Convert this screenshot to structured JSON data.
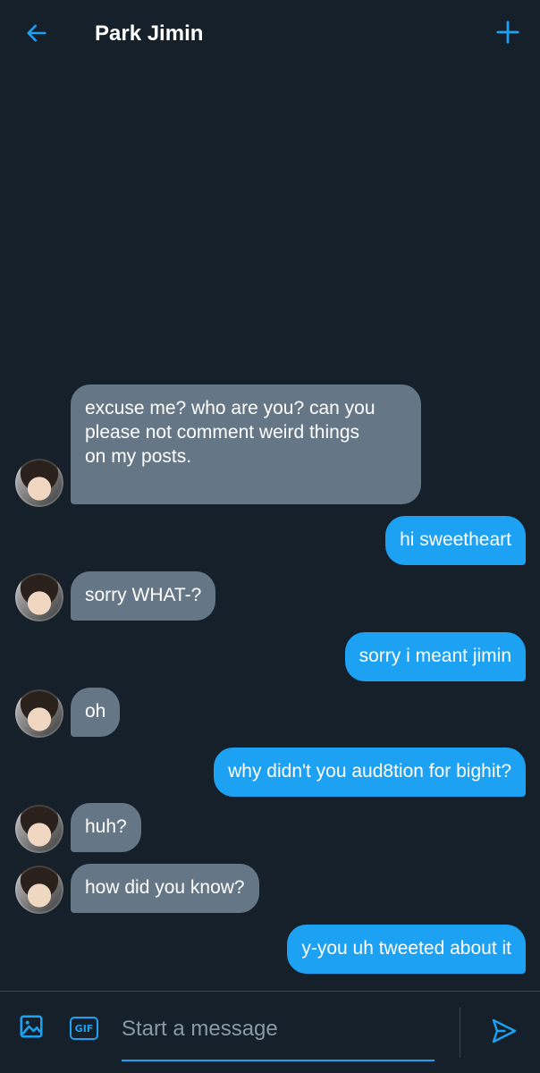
{
  "header": {
    "title": "Park Jimin",
    "back_icon": "arrow-left-icon",
    "plus_icon": "plus-icon"
  },
  "colors": {
    "background": "#15202b",
    "accent": "#1da1f2",
    "incoming_bubble": "#657786",
    "divider": "#38444d"
  },
  "messages": [
    {
      "direction": "in",
      "text": "excuse me? who are you? can you\nplease not comment weird things\non my posts."
    },
    {
      "direction": "out",
      "text": "hi sweetheart"
    },
    {
      "direction": "in",
      "text": "sorry WHAT-?"
    },
    {
      "direction": "out",
      "text": "sorry i meant jimin"
    },
    {
      "direction": "in",
      "text": "oh"
    },
    {
      "direction": "out",
      "text": "why didn't you aud8tion for bighit?"
    },
    {
      "direction": "in",
      "text": "huh?"
    },
    {
      "direction": "in",
      "text": "how did you know?"
    },
    {
      "direction": "out",
      "text": "y-you uh tweeted about it"
    }
  ],
  "composer": {
    "image_icon": "image-icon",
    "gif_label": "GIF",
    "placeholder": "Start a message",
    "send_icon": "send-icon"
  }
}
